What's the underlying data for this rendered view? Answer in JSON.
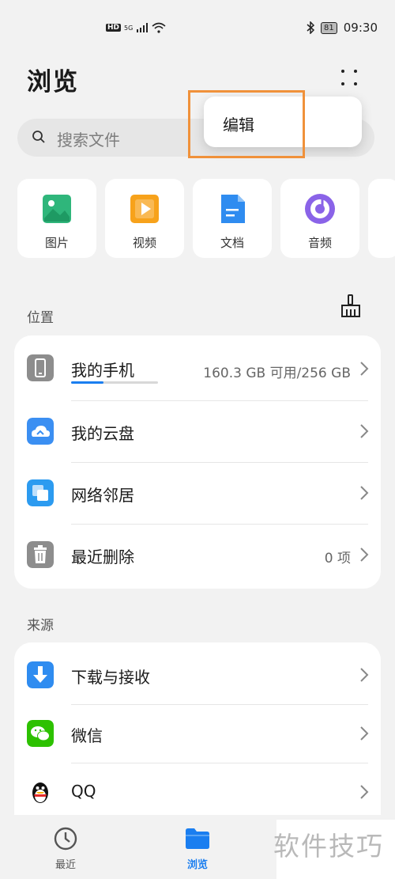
{
  "status_bar": {
    "network": "5G",
    "hd": "HD",
    "battery": "81",
    "time": "09:30"
  },
  "header": {
    "title": "浏览"
  },
  "search": {
    "placeholder": "搜索文件"
  },
  "popup_menu": {
    "items": [
      "编辑"
    ]
  },
  "categories": [
    {
      "label": "图片",
      "icon": "image-icon",
      "color": "#2fb67b"
    },
    {
      "label": "视频",
      "icon": "video-icon",
      "color": "#f7a21b"
    },
    {
      "label": "文档",
      "icon": "document-icon",
      "color": "#2f8cf0"
    },
    {
      "label": "音频",
      "icon": "audio-icon",
      "color": "#8a63e8"
    }
  ],
  "location": {
    "heading": "位置",
    "items": [
      {
        "label": "我的手机",
        "value": "160.3 GB 可用/256 GB",
        "usage": 0.37
      },
      {
        "label": "我的云盘",
        "value": ""
      },
      {
        "label": "网络邻居",
        "value": ""
      },
      {
        "label": "最近删除",
        "value": "0 项"
      }
    ]
  },
  "source": {
    "heading": "来源",
    "items": [
      {
        "label": "下载与接收"
      },
      {
        "label": "微信"
      },
      {
        "label": "QQ"
      }
    ]
  },
  "bottom_nav": {
    "tabs": [
      {
        "label": "最近",
        "active": false
      },
      {
        "label": "浏览",
        "active": true
      }
    ]
  },
  "watermark": "软件技巧",
  "colors": {
    "accent": "#1a7ef0",
    "highlight_box": "#f0913a",
    "background": "#f2f2f2"
  }
}
